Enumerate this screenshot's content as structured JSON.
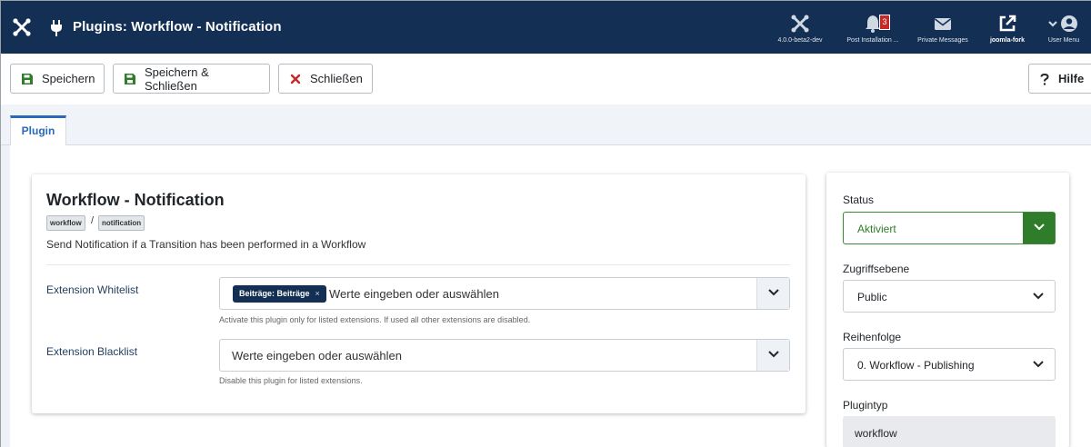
{
  "header": {
    "title": "Plugins: Workflow - Notification",
    "items": [
      {
        "icon": "joomla-icon",
        "label": "4.0.0-beta2-dev"
      },
      {
        "icon": "bell-icon",
        "label": "Post Installation ...",
        "badge": "3"
      },
      {
        "icon": "envelope-icon",
        "label": "Private Messages"
      },
      {
        "icon": "external-link-icon",
        "label": "joomla-fork"
      },
      {
        "icon": "user-icon",
        "label": "User Menu"
      }
    ]
  },
  "toolbar": {
    "save": "Speichern",
    "save_close": "Speichern & Schließen",
    "close": "Schließen",
    "help": "Hilfe"
  },
  "tabs": {
    "plugin": "Plugin"
  },
  "main": {
    "title": "Workflow - Notification",
    "tags": [
      "workflow",
      "notification"
    ],
    "tag_separator": "/",
    "description": "Send Notification if a Transition has been performed in a Workflow",
    "whitelist": {
      "label": "Extension Whitelist",
      "chip": "Beiträge: Beiträge",
      "chip_remove": "×",
      "placeholder": "Werte eingeben oder auswählen",
      "hint": "Activate this plugin only for listed extensions. If used all other extensions are disabled."
    },
    "blacklist": {
      "label": "Extension Blacklist",
      "placeholder": "Werte eingeben oder auswählen",
      "hint": "Disable this plugin for listed extensions."
    }
  },
  "sidebar": {
    "status": {
      "label": "Status",
      "value": "Aktiviert"
    },
    "access": {
      "label": "Zugriffsebene",
      "value": "Public"
    },
    "ordering": {
      "label": "Reihenfolge",
      "value": "0. Workflow - Publishing"
    },
    "plugintype": {
      "label": "Plugintyp",
      "value": "workflow"
    }
  },
  "colors": {
    "header_bg": "#132f53",
    "accent_blue": "#2a69b8",
    "save_green": "#2f7d2a",
    "close_red": "#c52827",
    "badge_red": "#c52827"
  }
}
